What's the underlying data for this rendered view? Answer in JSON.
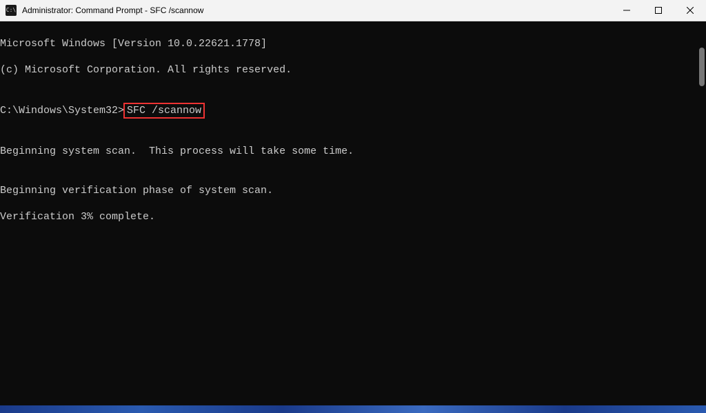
{
  "titlebar": {
    "icon_label": "C:\\",
    "title": "Administrator: Command Prompt - SFC  /scannow"
  },
  "terminal": {
    "line1": "Microsoft Windows [Version 10.0.22621.1778]",
    "line2": "(c) Microsoft Corporation. All rights reserved.",
    "prompt_path": "C:\\Windows\\System32>",
    "prompt_cmd": "SFC /scannow",
    "line_scan": "Beginning system scan.  This process will take some time.",
    "line_verify1": "Beginning verification phase of system scan.",
    "line_verify2": "Verification 3% complete."
  }
}
